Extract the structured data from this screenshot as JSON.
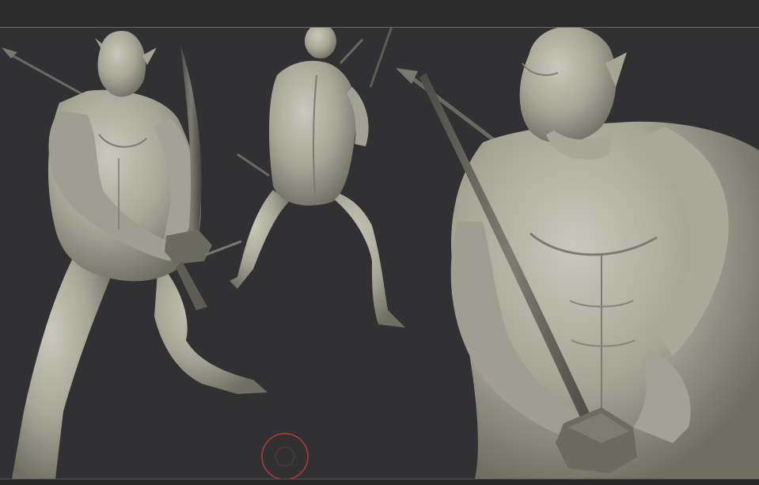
{
  "app": {
    "window": "ZBrush viewport",
    "views": [
      "front-view-figure",
      "back-view-figure",
      "closeup-view-figure"
    ]
  },
  "colors": {
    "background": "#313133",
    "clay": "#a6a596",
    "clay_shadow": "#6f6e63",
    "clay_highlight": "#c9c8ba",
    "sword": "#5e5d55",
    "cursor_ring": "#b33a3a"
  },
  "icons": {
    "brush_cursor": "brush-cursor-icon"
  }
}
